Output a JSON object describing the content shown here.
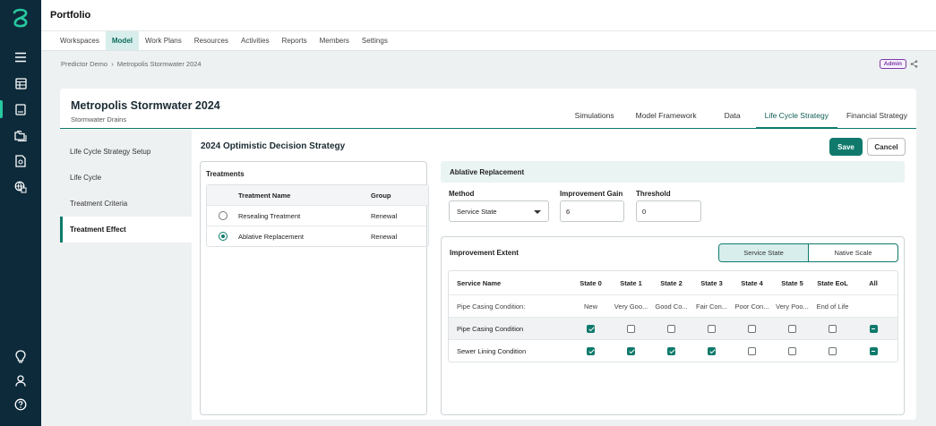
{
  "app": {
    "title": "Portfolio"
  },
  "nav": [
    {
      "label": "Workspaces",
      "active": false
    },
    {
      "label": "Model",
      "active": true
    },
    {
      "label": "Work Plans",
      "active": false
    },
    {
      "label": "Resources",
      "active": false
    },
    {
      "label": "Activities",
      "active": false
    },
    {
      "label": "Reports",
      "active": false
    },
    {
      "label": "Members",
      "active": false
    },
    {
      "label": "Settings",
      "active": false
    }
  ],
  "breadcrumb": {
    "parent": "Predictor Demo",
    "separator": "›",
    "current": "Metropolis Stormwater 2024"
  },
  "role_badge": "Admin",
  "project": {
    "title": "Metropolis Stormwater 2024",
    "subtitle": "Stormwater Drains"
  },
  "tabs": [
    {
      "label": "Simulations",
      "active": false
    },
    {
      "label": "Model Framework",
      "active": false
    },
    {
      "label": "Data",
      "active": false
    },
    {
      "label": "Life Cycle Strategy",
      "active": true
    },
    {
      "label": "Financial Strategy",
      "active": false
    }
  ],
  "sidebar": [
    {
      "label": "Life Cycle Strategy Setup",
      "active": false
    },
    {
      "label": "Life Cycle",
      "active": false
    },
    {
      "label": "Treatment Criteria",
      "active": false
    },
    {
      "label": "Treatment Effect",
      "active": true
    }
  ],
  "strategy_title": "2024 Optimistic Decision Strategy",
  "buttons": {
    "save": "Save",
    "cancel": "Cancel"
  },
  "treatments": {
    "title": "Treatments",
    "columns": {
      "name": "Treatment Name",
      "group": "Group"
    },
    "rows": [
      {
        "name": "Resealing Treatment",
        "group": "Renewal",
        "selected": false
      },
      {
        "name": "Ablative Replacement",
        "group": "Renewal",
        "selected": true
      }
    ]
  },
  "effect": {
    "title": "Ablative Replacement",
    "method_label": "Method",
    "method_value": "Service State",
    "gain_label": "Improvement Gain",
    "gain_value": "6",
    "threshold_label": "Threshold",
    "threshold_value": "0"
  },
  "extent": {
    "title": "Improvement Extent",
    "toggle": {
      "option_a": "Service State",
      "option_b": "Native Scale",
      "selected": "option_a"
    },
    "columns": [
      "Service Name",
      "State 0",
      "State 1",
      "State 2",
      "State 3",
      "State 4",
      "State 5",
      "State EoL",
      "All"
    ],
    "subheader": {
      "name": "Pipe Casing Condition:",
      "states": [
        "New",
        "Very Goo...",
        "Good Co...",
        "Fair Con...",
        "Poor Con...",
        "Very Poo...",
        "End of Life"
      ]
    },
    "rows": [
      {
        "name": "Pipe Casing Condition",
        "checks": [
          true,
          false,
          false,
          false,
          false,
          false,
          false
        ],
        "all": "indeterminate",
        "highlight": true
      },
      {
        "name": "Sewer Lining Condition",
        "checks": [
          true,
          true,
          true,
          true,
          false,
          false,
          false
        ],
        "all": "indeterminate",
        "highlight": false
      }
    ]
  },
  "colors": {
    "rail": "#0c2a3a",
    "accent": "#0f7a6c",
    "logo": "#28c9a0",
    "admin": "#7a3aa8"
  },
  "icons": {
    "rail_top": [
      "menu-icon",
      "table-icon",
      "book-icon",
      "folders-icon",
      "report-icon",
      "globe-icon"
    ],
    "rail_bottom": [
      "lightbulb-icon",
      "user-icon",
      "help-icon"
    ]
  }
}
